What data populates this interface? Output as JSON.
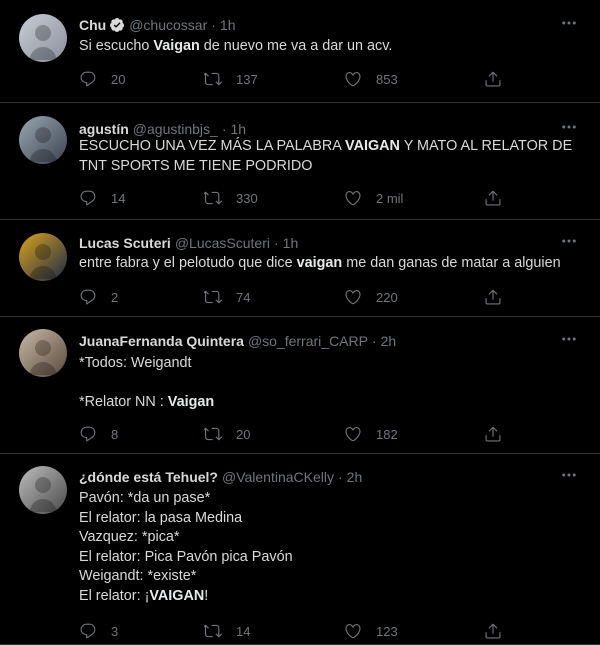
{
  "tweets": [
    {
      "name": "Chu",
      "verified": true,
      "handle": "@chucossar",
      "time": "1h",
      "lines": [
        [
          "Si escucho ",
          {
            "b": "Vaigan"
          },
          " de nuevo me va a dar un acv."
        ]
      ],
      "replies": "20",
      "retweets": "137",
      "likes": "853",
      "avatar_colors": [
        "#c9cdd6",
        "#8a8f9c"
      ]
    },
    {
      "name": "agustín",
      "verified": false,
      "handle": "@agustinbjs_",
      "time": "1h",
      "lines": [
        [
          "ESCUCHO UNA VEZ MÁS LA PALABRA ",
          {
            "b": "VAIGAN"
          },
          " Y MATO AL RELATOR DE"
        ],
        [
          "TNT SPORTS ME TIENE PODRIDO"
        ]
      ],
      "replies": "14",
      "retweets": "330",
      "likes": "2 mil",
      "avatar_colors": [
        "#9aa6b2",
        "#3b4450"
      ]
    },
    {
      "name": "Lucas Scuteri",
      "verified": false,
      "handle": "@LucasScuteri",
      "time": "1h",
      "lines": [
        [
          "entre fabra y el pelotudo que dice ",
          {
            "b": "vaigan"
          },
          " me dan ganas de matar a alguien"
        ]
      ],
      "replies": "2",
      "retweets": "74",
      "likes": "220",
      "avatar_colors": [
        "#d9a21b",
        "#1e2a4a"
      ]
    },
    {
      "name": "JuanaFernanda Quintera",
      "verified": false,
      "handle": "@so_ferrari_CARP",
      "time": "2h",
      "lines": [
        [
          "*Todos: Weigandt"
        ],
        [
          ""
        ],
        [
          "*Relator NN : ",
          {
            "b": "Vaigan"
          }
        ]
      ],
      "replies": "8",
      "retweets": "20",
      "likes": "182",
      "avatar_colors": [
        "#c8b8a6",
        "#5a4a3c"
      ]
    },
    {
      "name": "¿dónde está Tehuel?",
      "verified": false,
      "handle": "@ValentinaCKelly",
      "time": "2h",
      "lines": [
        [
          "Pavón: *da un pase*"
        ],
        [
          "El relator: la pasa Medina"
        ],
        [
          "Vazquez: *pica*"
        ],
        [
          "El relator: Pica Pavón pica Pavón"
        ],
        [
          "Weigandt: *existe*"
        ],
        [
          "El relator: ¡",
          {
            "b": "VAIGAN"
          },
          "!"
        ]
      ],
      "replies": "3",
      "retweets": "14",
      "likes": "123",
      "avatar_colors": [
        "#bdbdbd",
        "#4a4a4a"
      ]
    }
  ],
  "colors": {
    "background": "#000000",
    "text": "#d9d9d9",
    "muted": "#6e767d",
    "divider": "#2f3336",
    "verified": "#1d9bf0"
  },
  "icons": {
    "reply": "reply-icon",
    "retweet": "retweet-icon",
    "like": "heart-icon",
    "share": "share-icon",
    "more": "more-icon",
    "verified": "verified-badge-icon"
  }
}
